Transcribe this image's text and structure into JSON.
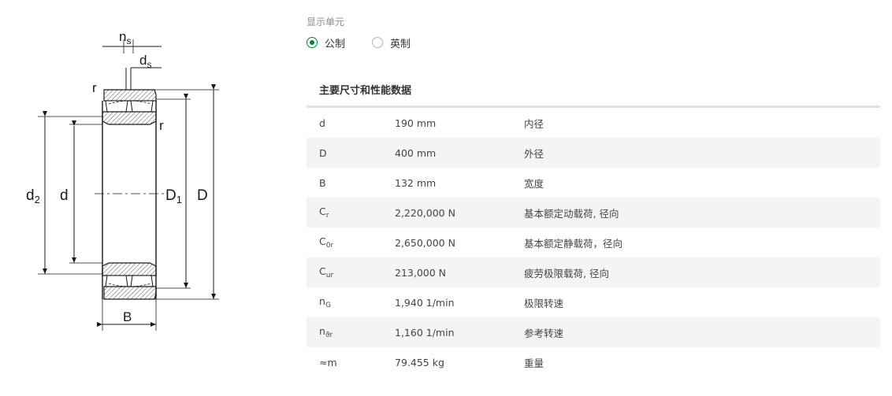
{
  "drawing": {
    "labels": {
      "ns_main": "n",
      "ns_sub": "s",
      "ds_main": "d",
      "ds_sub": "s",
      "r_top": "r",
      "r_side": "r",
      "d2_main": "d",
      "d2_sub": "2",
      "d": "d",
      "D1_main": "D",
      "D1_sub": "1",
      "D": "D",
      "B": "B"
    }
  },
  "units": {
    "label": "显示单元",
    "options": [
      {
        "label": "公制",
        "selected": true
      },
      {
        "label": "英制",
        "selected": false
      }
    ]
  },
  "table": {
    "title": "主要尺寸和性能数据",
    "rows": [
      {
        "sym": "d",
        "sub": "",
        "value": "190 mm",
        "desc": "内径"
      },
      {
        "sym": "D",
        "sub": "",
        "value": "400 mm",
        "desc": "外径"
      },
      {
        "sym": "B",
        "sub": "",
        "value": "132 mm",
        "desc": "宽度"
      },
      {
        "sym": "C",
        "sub": "r",
        "value": "2,220,000 N",
        "desc": "基本额定动载荷, 径向"
      },
      {
        "sym": "C",
        "sub": "0r",
        "value": "2,650,000 N",
        "desc": "基本额定静载荷，径向"
      },
      {
        "sym": "C",
        "sub": "ur",
        "value": "213,000 N",
        "desc": "疲劳极限载荷, 径向"
      },
      {
        "sym": "n",
        "sub": "G",
        "value": "1,940 1/min",
        "desc": "极限转速"
      },
      {
        "sym": "n",
        "sub": "ϑr",
        "value": "1,160 1/min",
        "desc": "参考转速"
      },
      {
        "sym": "≈m",
        "sub": "",
        "value": "79.455 kg",
        "desc": "重量"
      }
    ]
  }
}
